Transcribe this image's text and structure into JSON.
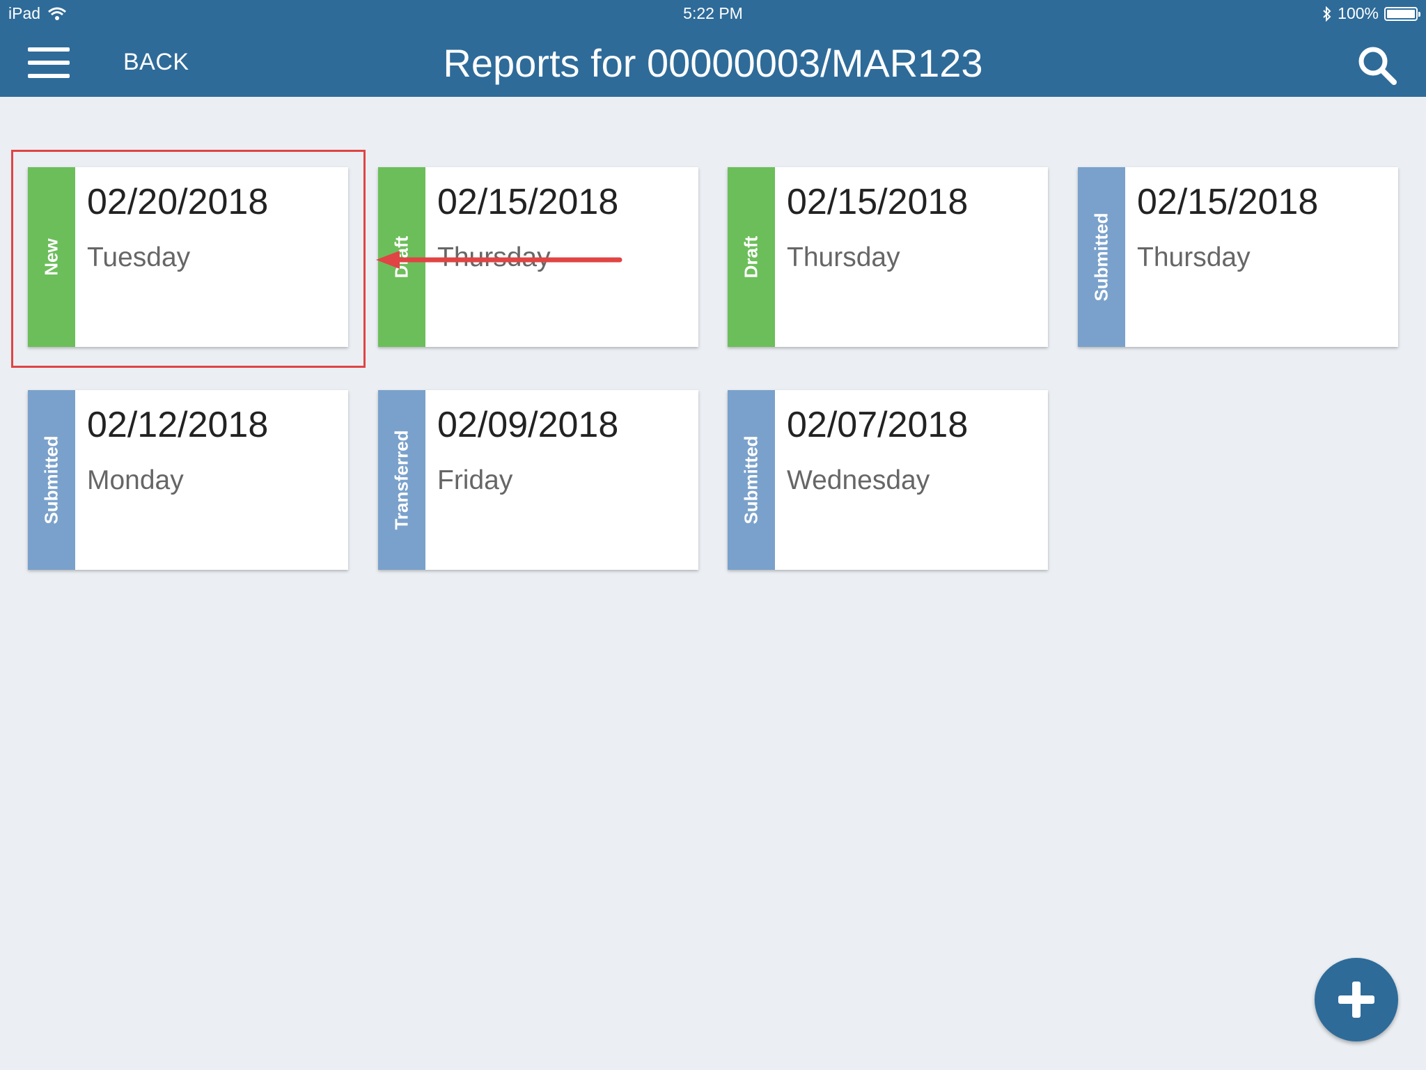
{
  "status_bar": {
    "device": "iPad",
    "time": "5:22 PM",
    "battery": "100%"
  },
  "header": {
    "back_label": "BACK",
    "title": "Reports for 00000003/MAR123"
  },
  "status_colors": {
    "New": "#6cbe5a",
    "Draft": "#6cbe5a",
    "Submitted": "#7aa1cb",
    "Transferred": "#7aa1cb"
  },
  "reports": [
    {
      "status": "New",
      "date": "02/20/2018",
      "day": "Tuesday"
    },
    {
      "status": "Draft",
      "date": "02/15/2018",
      "day": "Thursday"
    },
    {
      "status": "Draft",
      "date": "02/15/2018",
      "day": "Thursday"
    },
    {
      "status": "Submitted",
      "date": "02/15/2018",
      "day": "Thursday"
    },
    {
      "status": "Submitted",
      "date": "02/12/2018",
      "day": "Monday"
    },
    {
      "status": "Transferred",
      "date": "02/09/2018",
      "day": "Friday"
    },
    {
      "status": "Submitted",
      "date": "02/07/2018",
      "day": "Wednesday"
    }
  ],
  "icons": {
    "menu": "hamburger-menu-icon",
    "search": "search-icon",
    "add": "plus-icon",
    "wifi": "wifi-icon",
    "bluetooth": "bluetooth-icon",
    "battery": "battery-icon"
  },
  "annotation_color": "#e04444"
}
